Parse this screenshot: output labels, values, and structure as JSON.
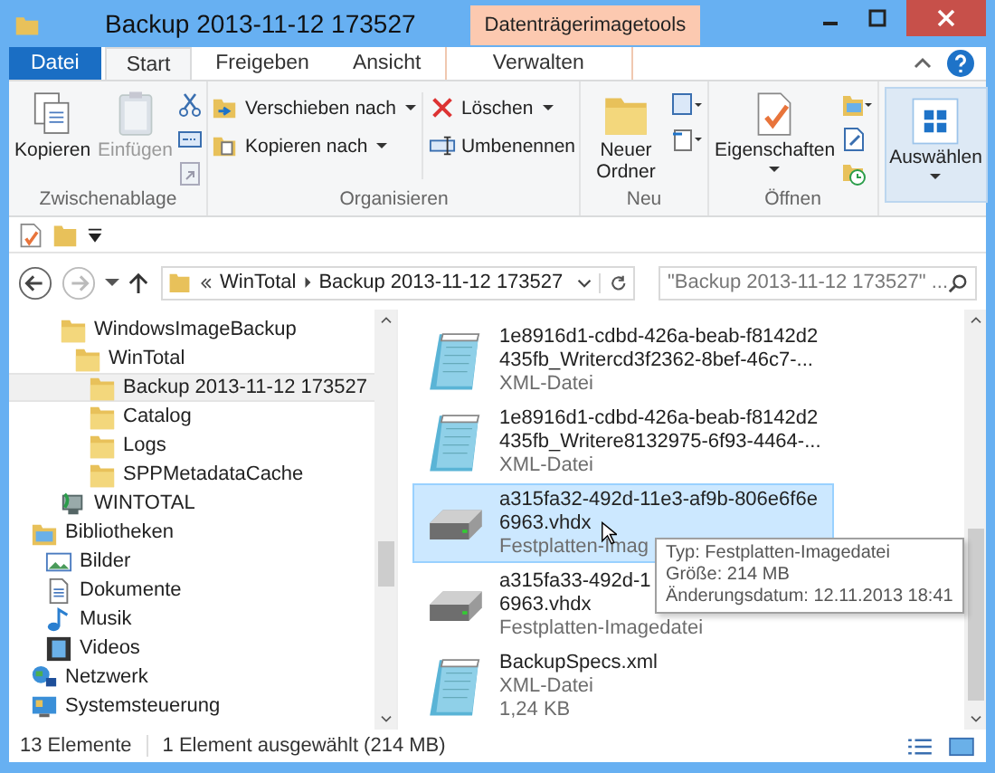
{
  "window": {
    "title": "Backup 2013-11-12 173527",
    "context_group": "Datenträgerimagetools"
  },
  "tabs": [
    {
      "label": "Datei",
      "kind": "file",
      "selected": false
    },
    {
      "label": "Start",
      "kind": "normal",
      "selected": true
    },
    {
      "label": "Freigeben",
      "kind": "normal",
      "selected": false
    },
    {
      "label": "Ansicht",
      "kind": "normal",
      "selected": false
    },
    {
      "label": "Verwalten",
      "kind": "context",
      "selected": false
    }
  ],
  "ribbon": [
    {
      "kind": "clipboard",
      "label": "Zwischenablage",
      "buttons": [
        {
          "label": "Kopieren",
          "disabled": false
        },
        {
          "label": "Einfügen",
          "disabled": true
        }
      ]
    },
    {
      "kind": "organize",
      "label": "Organisieren",
      "buttons": [
        {
          "label": "Verschieben nach"
        },
        {
          "label": "Kopieren nach"
        },
        {
          "label": "Löschen"
        },
        {
          "label": "Umbenennen"
        }
      ]
    },
    {
      "kind": "new",
      "label": "Neu",
      "buttons": [
        {
          "label": "Neuer Ordner"
        }
      ]
    },
    {
      "kind": "open",
      "label": "Öffnen",
      "buttons": [
        {
          "label": "Eigenschaften"
        }
      ]
    },
    {
      "kind": "select",
      "buttons": [
        {
          "label": "Auswählen"
        }
      ]
    }
  ],
  "address": {
    "crumbs": [
      "WinTotal",
      "Backup 2013-11-12 173527"
    ]
  },
  "search": {
    "placeholder": "\"Backup 2013-11-12 173527\" ..."
  },
  "tree": [
    {
      "label": "WindowsImageBackup",
      "kind": "folder",
      "children": [
        {
          "label": "WinTotal",
          "kind": "folder",
          "children": [
            {
              "label": "Backup 2013-11-12 173527",
              "kind": "folder",
              "selected": true
            },
            {
              "label": "Catalog",
              "kind": "folder",
              "selected": false
            },
            {
              "label": "Logs",
              "kind": "folder",
              "selected": false
            },
            {
              "label": "SPPMetadataCache",
              "kind": "folder",
              "selected": false
            }
          ]
        }
      ]
    },
    {
      "label": "WINTOTAL",
      "kind": "computer"
    },
    {
      "label": "Bibliotheken",
      "kind": "library",
      "children": [
        {
          "label": "Bilder",
          "kind": "pictures"
        },
        {
          "label": "Dokumente",
          "kind": "documents"
        },
        {
          "label": "Musik",
          "kind": "music"
        },
        {
          "label": "Videos",
          "kind": "videos"
        }
      ]
    },
    {
      "label": "Netzwerk",
      "kind": "network"
    },
    {
      "label": "Systemsteuerung",
      "kind": "control"
    }
  ],
  "files": [
    {
      "kind": "xml",
      "name": [
        "1e8916d1-cdbd-426a-beab-f8142d2",
        "435fb_Writercd3f2362-8bef-46c7-..."
      ],
      "type": "XML-Datei",
      "selected": false
    },
    {
      "kind": "xml",
      "name": [
        "1e8916d1-cdbd-426a-beab-f8142d2",
        "435fb_Writere8132975-6f93-4464-..."
      ],
      "type": "XML-Datei",
      "selected": false
    },
    {
      "kind": "vhdx",
      "name": [
        "a315fa32-492d-11e3-af9b-806e6f6e",
        "6963.vhdx"
      ],
      "type": "Festplatten-Imag",
      "selected": true
    },
    {
      "kind": "vhdx",
      "name": [
        "a315fa33-492d-1",
        "6963.vhdx"
      ],
      "type": "Festplatten-Imagedatei",
      "selected": false
    },
    {
      "kind": "xml",
      "name": [
        "BackupSpecs.xml"
      ],
      "type": "XML-Datei",
      "size": "1,24 KB",
      "selected": false
    }
  ],
  "tooltip": [
    "Typ: Festplatten-Imagedatei",
    "Größe: 214 MB",
    "Änderungsdatum: 12.11.2013 18:41"
  ],
  "status_bar": {
    "count": "13 Elemente",
    "selection": "1 Element ausgewählt (214 MB)"
  }
}
